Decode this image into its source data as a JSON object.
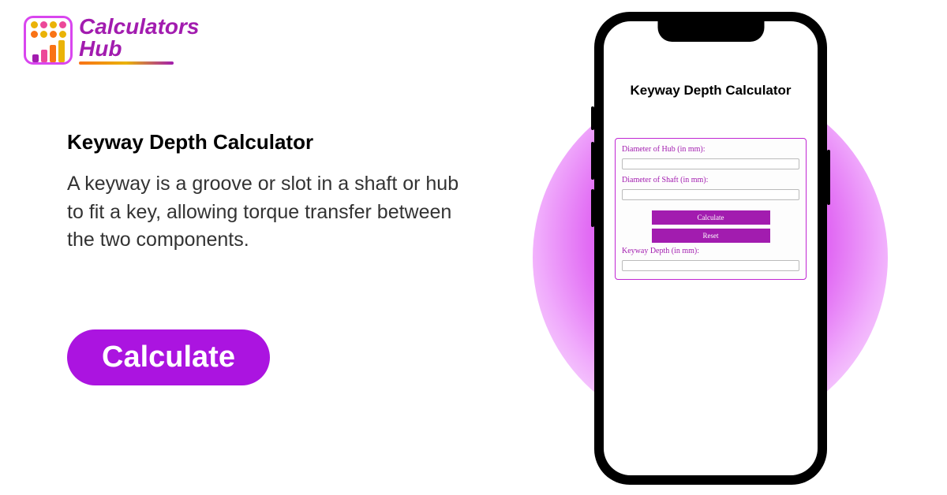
{
  "logo": {
    "word1": "Calculators",
    "word2": "Hub"
  },
  "main": {
    "title": "Keyway Depth Calculator",
    "description": "A keyway is a groove or slot in a shaft or hub to fit a key, allowing torque transfer between the two components.",
    "cta_label": "Calculate"
  },
  "phone": {
    "title": "Keyway Depth Calculator",
    "form": {
      "hub_label": "Diameter of Hub (in mm):",
      "shaft_label": "Diameter of Shaft (in mm):",
      "calculate_label": "Calculate",
      "reset_label": "Reset",
      "result_label": "Keyway Depth (in mm):"
    }
  },
  "colors": {
    "primary": "#a21caf",
    "accent": "#c026d3"
  }
}
